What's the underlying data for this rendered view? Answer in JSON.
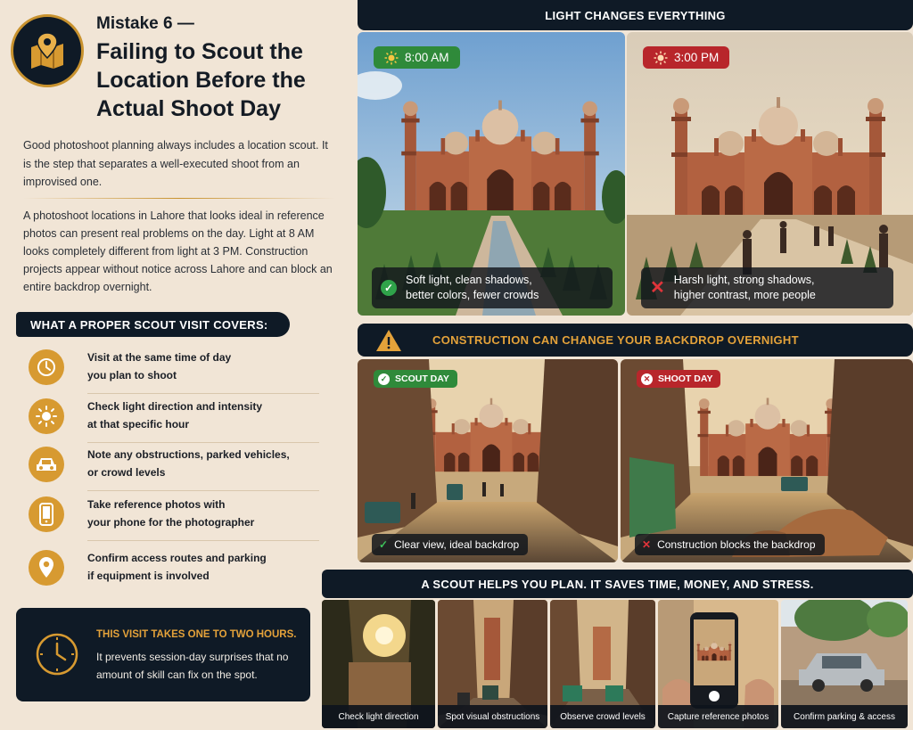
{
  "header": {
    "kicker": "Mistake 6 —",
    "title": "Failing to Scout the Location Before the Actual Shoot Day",
    "icon": "map-pin-icon"
  },
  "intro": "Good photoshoot planning always includes a location scout. It is the step that separates a well-executed shoot from an improvised one.",
  "body": "A photoshoot locations in Lahore that looks ideal in reference photos can present real problems on the day. Light at 8 AM looks completely different from light at 3 PM. Construction projects appear without notice across Lahore and can block an entire backdrop overnight.",
  "covers": {
    "heading": "WHAT A PROPER SCOUT VISIT COVERS:",
    "items": [
      {
        "line1": "Visit at the same time of day",
        "line2": "you plan to shoot",
        "icon": "clock-icon"
      },
      {
        "line1": "Check light direction and intensity",
        "line2": "at that specific hour",
        "icon": "sun-icon"
      },
      {
        "line1": "Note any obstructions, parked vehicles,",
        "line2": "or crowd levels",
        "icon": "car-icon"
      },
      {
        "line1": "Take reference photos with",
        "line2": "your phone for the photographer",
        "icon": "phone-icon"
      },
      {
        "line1": "Confirm access routes and parking",
        "line2": "if equipment is involved",
        "icon": "location-pin-icon"
      }
    ]
  },
  "note": {
    "title": "THIS VISIT TAKES ONE TO TWO HOURS.",
    "text": "It prevents session-day surprises that no amount of skill can fix on the spot."
  },
  "light": {
    "heading": "LIGHT CHANGES EVERYTHING",
    "morning": {
      "time": "8:00 AM",
      "caption1": "Soft light, clean shadows,",
      "caption2": "better colors, fewer crowds",
      "color": "#2f8a3a"
    },
    "afternoon": {
      "time": "3:00 PM",
      "caption1": "Harsh light, strong shadows,",
      "caption2": "higher contrast, more people",
      "color": "#b8262b"
    }
  },
  "construction": {
    "heading": "CONSTRUCTION CAN CHANGE YOUR BACKDROP OVERNIGHT",
    "scout": {
      "badge": "SCOUT DAY",
      "caption": "Clear view, ideal backdrop"
    },
    "shoot": {
      "badge": "SHOOT DAY",
      "caption": "Construction blocks the backdrop"
    }
  },
  "plan": {
    "heading": "A SCOUT HELPS YOU PLAN. IT SAVES TIME, MONEY, AND STRESS.",
    "thumbs": [
      {
        "label": "Check light direction"
      },
      {
        "label": "Spot visual obstructions"
      },
      {
        "label": "Observe crowd levels"
      },
      {
        "label": "Capture reference photos"
      },
      {
        "label": "Confirm parking & access"
      }
    ]
  },
  "colors": {
    "navy": "#0f1a26",
    "gold": "#d79a31",
    "cream": "#f1e5d6",
    "green": "#2fa34a",
    "red": "#e0343a"
  }
}
